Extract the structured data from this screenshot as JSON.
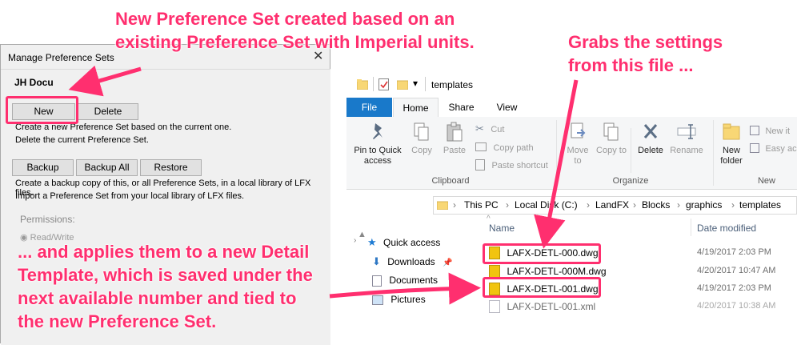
{
  "dialog": {
    "title": "Manage Preference Sets",
    "close_glyph": "✕",
    "set_name": "JH Docu",
    "new_label": "New",
    "delete_label": "Delete",
    "new_desc": "Create a new Preference Set based on the current one.",
    "delete_desc": "Delete the current Preference Set.",
    "backup_label": "Backup",
    "backup_all_label": "Backup All",
    "restore_label": "Restore",
    "backup_desc": "Create a backup copy of this, or all Preference Sets, in a local library of LFX files.",
    "import_desc": "Import a Preference Set from your local library of LFX files.",
    "permissions_label": "Permissions:",
    "read_write_label": "Read/Write"
  },
  "explorer": {
    "window_title": "templates",
    "qat_arrow": "▾",
    "tabs": [
      "File",
      "Home",
      "Share",
      "View"
    ],
    "ribbon": {
      "pin_label": "Pin to Quick access",
      "copy_label": "Copy",
      "paste_label": "Paste",
      "cut_label": "Cut",
      "copy_path_label": "Copy path",
      "paste_shortcut_label": "Paste shortcut",
      "clipboard_group": "Clipboard",
      "move_to_label": "Move to",
      "copy_to_label": "Copy to",
      "delete_label": "Delete",
      "rename_label": "Rename",
      "organize_group": "Organize",
      "new_folder_label": "New folder",
      "new_item_label": "New it",
      "easy_access_label": "Easy ac",
      "new_group": "New"
    },
    "address": [
      "This PC",
      "Local Disk (C:)",
      "LandFX",
      "Blocks",
      "graphics",
      "templates"
    ],
    "columns": {
      "name": "Name",
      "date": "Date modified"
    },
    "nav": [
      {
        "label": "Quick access",
        "icon": "star-icon"
      },
      {
        "label": "Downloads",
        "icon": "download-icon"
      },
      {
        "label": "Documents",
        "icon": "documents-icon"
      },
      {
        "label": "Pictures",
        "icon": "pictures-icon"
      }
    ],
    "files": [
      {
        "name": "LAFX-DETL-000.dwg",
        "date": "4/19/2017 2:03 PM"
      },
      {
        "name": "LAFX-DETL-000M.dwg",
        "date": "4/20/2017 10:47 AM"
      },
      {
        "name": "LAFX-DETL-001.dwg",
        "date": "4/19/2017 2:03 PM"
      },
      {
        "name": "LAFX-DETL-001.xml",
        "date": "4/20/2017 10:38 AM"
      }
    ]
  },
  "annotations": {
    "top_line1": "New Preference Set created  based on an",
    "top_line2": "existing Preference Set with Imperial units.",
    "right_line1": "Grabs the settings",
    "right_line2": "from this file ...",
    "bottom_line1": "... and applies them to a new Detail",
    "bottom_line2": "Template, which is saved under the",
    "bottom_line3": "next available number and tied to",
    "bottom_line4": "the new Preference Set."
  },
  "colors": {
    "annotation": "#ff2f6f",
    "file_tab": "#1979ca"
  }
}
